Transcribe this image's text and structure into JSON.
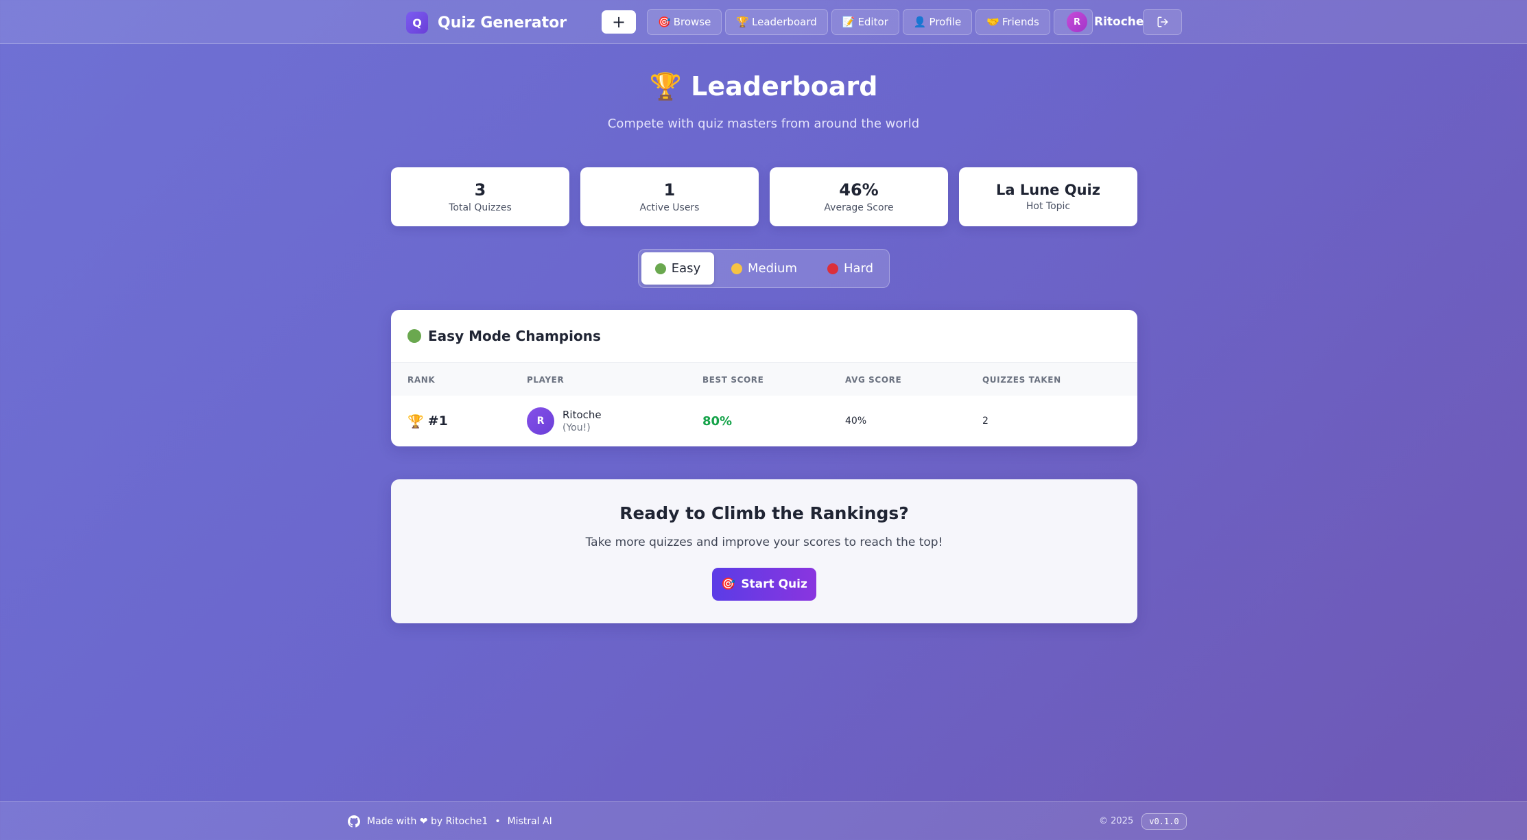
{
  "header": {
    "brand_letter": "Q",
    "brand_name": "Quiz Generator",
    "create_label": "+",
    "nav": [
      {
        "icon": "🎯",
        "label": "Browse"
      },
      {
        "icon": "🏆",
        "label": "Leaderboard"
      },
      {
        "icon": "📝",
        "label": "Editor"
      },
      {
        "icon": "👤",
        "label": "Profile"
      },
      {
        "icon": "🤝",
        "label": "Friends"
      }
    ],
    "user_initial": "R",
    "user_name": "Ritoche"
  },
  "hero": {
    "icon": "🏆",
    "title": "Leaderboard",
    "subtitle": "Compete with quiz masters from around the world"
  },
  "stats": [
    {
      "value": "3",
      "label": "Total Quizzes"
    },
    {
      "value": "1",
      "label": "Active Users"
    },
    {
      "value": "46%",
      "label": "Average Score"
    },
    {
      "value": "La Lune Quiz",
      "label": "Hot Topic"
    }
  ],
  "difficulty_tabs": [
    {
      "label": "Easy",
      "color": "#6aa84f",
      "active": true
    },
    {
      "label": "Medium",
      "color": "#f6c344",
      "active": false
    },
    {
      "label": "Hard",
      "color": "#dc2f3b",
      "active": false
    }
  ],
  "leaderboard": {
    "title": "Easy Mode Champions",
    "title_dot_color": "#6aa84f",
    "columns": [
      "RANK",
      "PLAYER",
      "BEST SCORE",
      "AVG SCORE",
      "QUIZZES TAKEN"
    ],
    "rows": [
      {
        "rank_icon": "🏆",
        "rank": "#1",
        "initial": "R",
        "player": "Ritoche",
        "tag": "(You!)",
        "best": "80%",
        "avg": "40%",
        "taken": "2"
      }
    ]
  },
  "cta": {
    "title": "Ready to Climb the Rankings?",
    "subtitle": "Take more quizzes and improve your scores to reach the top!",
    "button_icon": "🎯",
    "button_label": "Start Quiz"
  },
  "footer": {
    "made_with": "Made with ❤ by Ritoche1",
    "separator": "•",
    "partner": "Mistral AI",
    "copyright": "© 2025",
    "version": "v0.1.0"
  }
}
